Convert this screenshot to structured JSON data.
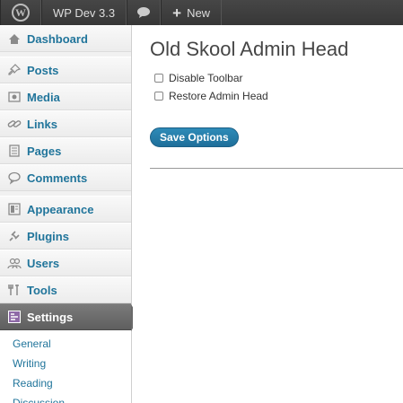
{
  "adminbar": {
    "site_name": "WP Dev 3.3",
    "new_label": "New"
  },
  "sidebar": {
    "items": [
      {
        "label": "Dashboard",
        "icon": "dashboard-icon"
      },
      {
        "label": "Posts",
        "icon": "pushpin-icon"
      },
      {
        "label": "Media",
        "icon": "media-icon"
      },
      {
        "label": "Links",
        "icon": "link-icon"
      },
      {
        "label": "Pages",
        "icon": "pages-icon"
      },
      {
        "label": "Comments",
        "icon": "comment-icon"
      },
      {
        "label": "Appearance",
        "icon": "appearance-icon"
      },
      {
        "label": "Plugins",
        "icon": "plug-icon"
      },
      {
        "label": "Users",
        "icon": "users-icon"
      },
      {
        "label": "Tools",
        "icon": "tools-icon"
      },
      {
        "label": "Settings",
        "icon": "settings-icon"
      }
    ],
    "submenu": [
      "General",
      "Writing",
      "Reading",
      "Discussion"
    ]
  },
  "main": {
    "title": "Old Skool Admin Head",
    "options": [
      {
        "label": "Disable Toolbar",
        "checked": false
      },
      {
        "label": "Restore Admin Head",
        "checked": false
      }
    ],
    "save_label": "Save Options"
  },
  "colors": {
    "adminbar": "#464646",
    "link": "#21759b",
    "button": "#2e8bb8",
    "current_menu": "#6a6a6a"
  }
}
